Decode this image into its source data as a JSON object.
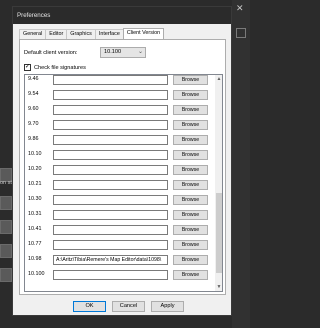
{
  "window": {
    "title": "Preferences"
  },
  "tabs": [
    "General",
    "Editor",
    "Graphics",
    "Interface",
    "Client Version"
  ],
  "active_tab": "Client Version",
  "default_client": {
    "label": "Default client version:",
    "value": "10.100"
  },
  "check_signatures": {
    "label": "Check file signatures",
    "checked": true
  },
  "browse_label": "Browse",
  "versions": [
    {
      "version": "9.46",
      "path": ""
    },
    {
      "version": "9.54",
      "path": ""
    },
    {
      "version": "9.60",
      "path": ""
    },
    {
      "version": "9.70",
      "path": ""
    },
    {
      "version": "9.86",
      "path": ""
    },
    {
      "version": "10.10",
      "path": ""
    },
    {
      "version": "10.20",
      "path": ""
    },
    {
      "version": "10.21",
      "path": ""
    },
    {
      "version": "10.30",
      "path": ""
    },
    {
      "version": "10.31",
      "path": ""
    },
    {
      "version": "10.41",
      "path": ""
    },
    {
      "version": "10.77",
      "path": ""
    },
    {
      "version": "10.98",
      "path": "A:\\Aritz\\Tibia\\Remere's Map Editor\\data\\1098\\"
    },
    {
      "version": "10.100",
      "path": ""
    }
  ],
  "buttons": {
    "ok": "OK",
    "cancel": "Cancel",
    "apply": "Apply"
  },
  "background": {
    "partial_label": "on sta"
  },
  "icons": {
    "select_arrow": "chevron-down-icon",
    "checkbox": "check-icon",
    "close": "close-icon"
  }
}
